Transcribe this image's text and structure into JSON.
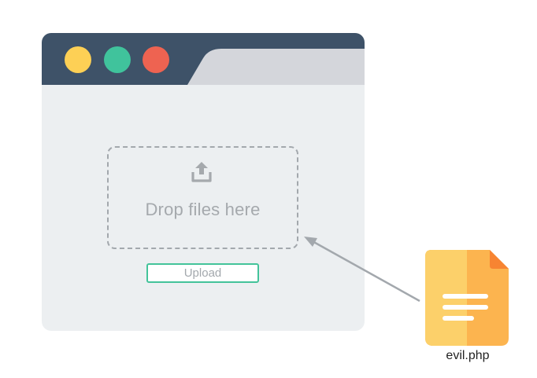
{
  "browser": {
    "window_controls": [
      {
        "name": "yellow",
        "color": "#fdd055"
      },
      {
        "name": "green",
        "color": "#40c39c"
      },
      {
        "name": "red",
        "color": "#ee6351"
      }
    ],
    "titlebar_color": "#3e5268",
    "tab_color": "#d4d6db",
    "body_color": "#eceff1"
  },
  "dropzone": {
    "icon": "upload-icon",
    "text": "Drop files here"
  },
  "upload_button": {
    "label": "Upload",
    "border_color": "#43c39a"
  },
  "file": {
    "icon": "document-icon",
    "name": "evil.php",
    "colors": {
      "left": "#fcd06a",
      "right": "#fcb44f",
      "fold": "#f78432"
    }
  }
}
